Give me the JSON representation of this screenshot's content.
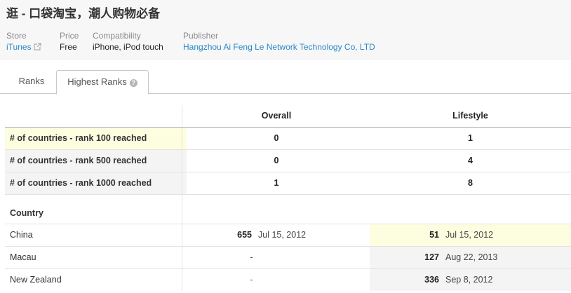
{
  "app": {
    "title": "逛 - 口袋淘宝，潮人购物必备"
  },
  "meta": {
    "store_label": "Store",
    "store_value": "iTunes",
    "price_label": "Price",
    "price_value": "Free",
    "compat_label": "Compatibility",
    "compat_value": "iPhone, iPod touch",
    "publisher_label": "Publisher",
    "publisher_value": "Hangzhou Ai Feng Le Network Technology Co, LTD"
  },
  "tabs": [
    {
      "label": "Ranks"
    },
    {
      "label": "Highest Ranks"
    }
  ],
  "table": {
    "col_overall": "Overall",
    "col_lifestyle": "Lifestyle",
    "summary_rows": [
      {
        "label": "# of countries - rank 100 reached",
        "overall": "0",
        "lifestyle": "1"
      },
      {
        "label": "# of countries - rank 500 reached",
        "overall": "0",
        "lifestyle": "4"
      },
      {
        "label": "# of countries - rank 1000 reached",
        "overall": "1",
        "lifestyle": "8"
      }
    ],
    "country_header": "Country",
    "countries": [
      {
        "name": "China",
        "overall_rank": "655",
        "overall_date": "Jul 15, 2012",
        "lifestyle_rank": "51",
        "lifestyle_date": "Jul 15, 2012"
      },
      {
        "name": "Macau",
        "overall_rank": "",
        "overall_date": "",
        "overall_dash": "-",
        "lifestyle_rank": "127",
        "lifestyle_date": "Aug 22, 2013"
      },
      {
        "name": "New Zealand",
        "overall_rank": "",
        "overall_date": "",
        "overall_dash": "-",
        "lifestyle_rank": "336",
        "lifestyle_date": "Sep 8, 2012"
      }
    ]
  },
  "colors": {
    "link": "#2b87c7",
    "highlight": "#fdfde0",
    "row_gray": "#f4f4f4"
  },
  "icons": [
    "external-link-icon",
    "help-icon"
  ]
}
